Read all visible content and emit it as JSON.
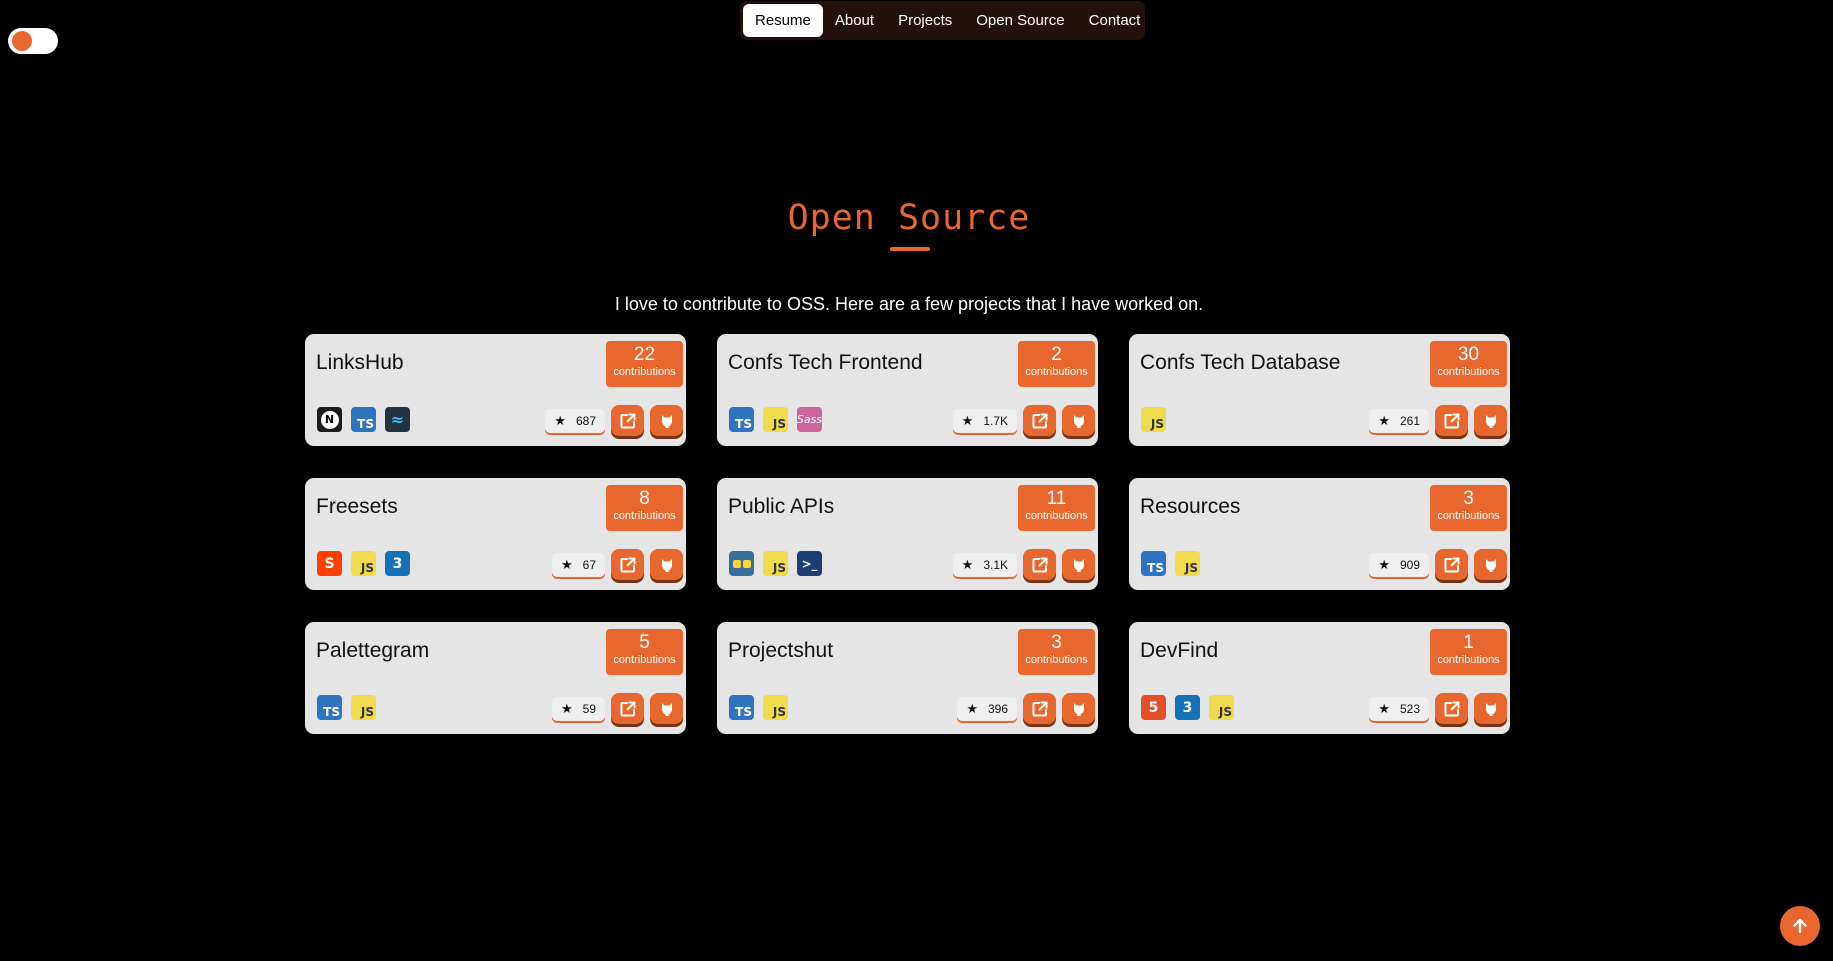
{
  "nav": {
    "items": [
      "Resume",
      "About",
      "Projects",
      "Open Source",
      "Contact"
    ],
    "active": "Resume"
  },
  "section": {
    "title": "Open Source",
    "subtitle": "I love to contribute to OSS. Here are a few projects that I have worked on."
  },
  "contributions_label": "contributions",
  "projects": [
    {
      "name": "LinksHub",
      "contributions": "22",
      "stars": "687",
      "techs": [
        "next-icon",
        "ts-icon",
        "tailwind-icon"
      ]
    },
    {
      "name": "Confs Tech Frontend",
      "contributions": "2",
      "stars": "1.7K",
      "techs": [
        "ts-icon",
        "js-icon",
        "sass-icon"
      ]
    },
    {
      "name": "Confs Tech Database",
      "contributions": "30",
      "stars": "261",
      "techs": [
        "js-icon"
      ]
    },
    {
      "name": "Freesets",
      "contributions": "8",
      "stars": "67",
      "techs": [
        "svelte-icon",
        "js-icon",
        "css-icon"
      ]
    },
    {
      "name": "Public APIs",
      "contributions": "11",
      "stars": "3.1K",
      "techs": [
        "python-icon",
        "js-icon",
        "powershell-icon"
      ]
    },
    {
      "name": "Resources",
      "contributions": "3",
      "stars": "909",
      "techs": [
        "ts-icon",
        "js-icon"
      ]
    },
    {
      "name": "Palettegram",
      "contributions": "5",
      "stars": "59",
      "techs": [
        "ts-icon",
        "js-icon"
      ]
    },
    {
      "name": "Projectshut",
      "contributions": "3",
      "stars": "396",
      "techs": [
        "ts-icon",
        "js-icon"
      ]
    },
    {
      "name": "DevFind",
      "contributions": "1",
      "stars": "523",
      "techs": [
        "html-icon",
        "css-icon",
        "js-icon"
      ]
    }
  ],
  "colors": {
    "accent": "#e8672f",
    "card": "#e5e5e5",
    "background": "#000000"
  }
}
